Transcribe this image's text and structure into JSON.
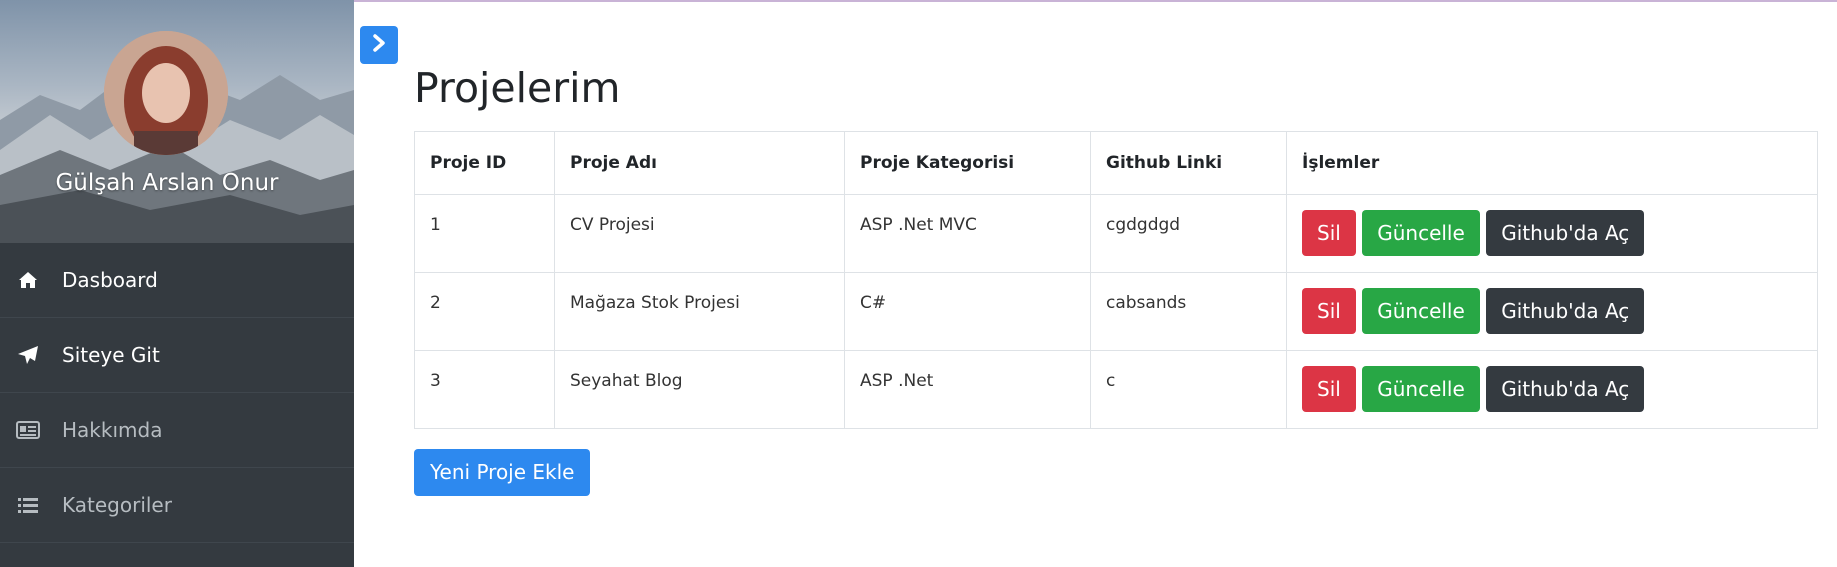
{
  "profile": {
    "name": "Gülşah Arslan Onur"
  },
  "sidebar": {
    "items": [
      {
        "label": "Dasboard",
        "icon": "home-icon"
      },
      {
        "label": "Siteye Git",
        "icon": "paper-plane-icon"
      },
      {
        "label": "Hakkımda",
        "icon": "id-card-icon"
      },
      {
        "label": "Kategoriler",
        "icon": "list-icon"
      }
    ]
  },
  "page": {
    "title": "Projelerim"
  },
  "table": {
    "headers": [
      "Proje ID",
      "Proje Adı",
      "Proje Kategorisi",
      "Github Linki",
      "İşlemler"
    ],
    "rows": [
      {
        "id": "1",
        "name": "CV Projesi",
        "category": "ASP .Net MVC",
        "github": "cgdgdgd"
      },
      {
        "id": "2",
        "name": "Mağaza Stok Projesi",
        "category": "C#",
        "github": "cabsands"
      },
      {
        "id": "3",
        "name": "Seyahat Blog",
        "category": "ASP .Net",
        "github": "c"
      }
    ]
  },
  "actions": {
    "delete_label": "Sil",
    "update_label": "Güncelle",
    "github_label": "Github'da Aç"
  },
  "add_button": {
    "label": "Yeni Proje Ekle"
  },
  "colors": {
    "primary": "#2d89ef",
    "danger": "#dc3545",
    "success": "#28a745",
    "dark": "#343a40",
    "sidebar": "#343a40"
  }
}
